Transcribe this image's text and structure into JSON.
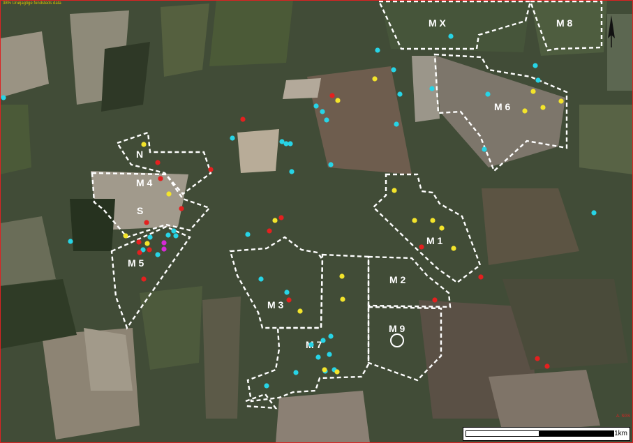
{
  "map": {
    "attribution": "38% Unøjagtige fundsteds data",
    "scale_label": "1km",
    "corner_note": "A. SGS",
    "colors": {
      "cyan": "#27d4e6",
      "yellow": "#f3e42b",
      "red": "#e4201f",
      "magenta": "#d62ad6",
      "boundary": "#ffffff"
    }
  },
  "areas": [
    {
      "id": "MX",
      "label": "M X"
    },
    {
      "id": "M8",
      "label": "M 8"
    },
    {
      "id": "M6",
      "label": "M 6"
    },
    {
      "id": "N",
      "label": "N"
    },
    {
      "id": "M4",
      "label": "M 4"
    },
    {
      "id": "S",
      "label": "S"
    },
    {
      "id": "M5",
      "label": "M 5"
    },
    {
      "id": "M1",
      "label": "M 1"
    },
    {
      "id": "M2",
      "label": "M 2"
    },
    {
      "id": "M3",
      "label": "M 3"
    },
    {
      "id": "M9",
      "label": "M 9"
    },
    {
      "id": "M7",
      "label": "M 7"
    }
  ]
}
